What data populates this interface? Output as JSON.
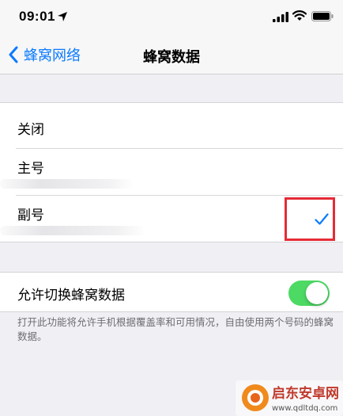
{
  "status_bar": {
    "time": "09:01"
  },
  "nav": {
    "back_label": "蜂窝网络",
    "title": "蜂窝数据"
  },
  "options": [
    {
      "label": "关闭",
      "selected": false
    },
    {
      "label": "主号",
      "selected": false
    },
    {
      "label": "副号",
      "selected": true
    }
  ],
  "allow_switching": {
    "label": "允许切换蜂窝数据",
    "enabled": true,
    "footnote": "打开此功能将允许手机根据覆盖率和可用情况，自由使用两个号码的蜂窝数据。"
  },
  "watermark": {
    "title": "启东安卓网",
    "url": "www.qdltdq.com"
  },
  "colors": {
    "accent": "#0a7aff",
    "toggle_on": "#4cd964",
    "highlight": "#e52b36"
  }
}
